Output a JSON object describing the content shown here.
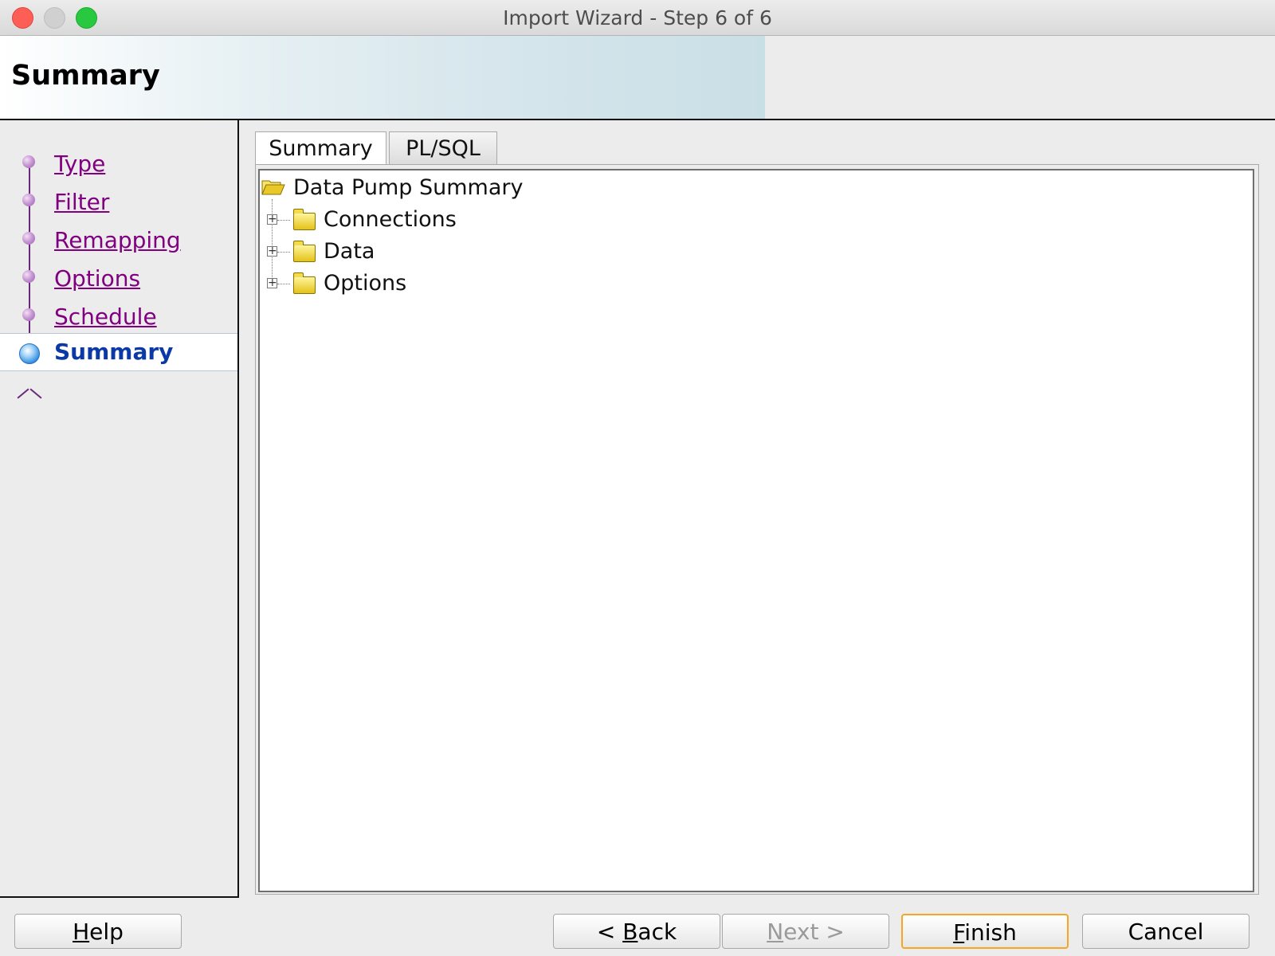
{
  "window": {
    "title": "Import Wizard - Step 6 of 6"
  },
  "header": {
    "title": "Summary"
  },
  "nav": {
    "items": [
      {
        "label": "Type",
        "state": "visited"
      },
      {
        "label": "Filter",
        "state": "visited"
      },
      {
        "label": "Remapping",
        "state": "visited"
      },
      {
        "label": "Options",
        "state": "visited"
      },
      {
        "label": "Schedule",
        "state": "visited"
      },
      {
        "label": "Summary",
        "state": "current"
      }
    ]
  },
  "tabs": [
    {
      "label": "Summary",
      "selected": true
    },
    {
      "label": "PL/SQL",
      "selected": false
    }
  ],
  "tree": {
    "root": {
      "label": "Data Pump Summary",
      "icon": "folder-open-icon"
    },
    "children": [
      {
        "label": "Connections",
        "icon": "folder-icon",
        "expandable": true
      },
      {
        "label": "Data",
        "icon": "folder-icon",
        "expandable": true
      },
      {
        "label": "Options",
        "icon": "folder-icon",
        "expandable": true
      }
    ]
  },
  "buttons": {
    "help": {
      "mnemonic": "H",
      "rest": "elp"
    },
    "back": {
      "prefix": "< ",
      "mnemonic": "B",
      "rest": "ack"
    },
    "next": {
      "mnemonic": "N",
      "rest": "ext >",
      "enabled": false
    },
    "finish": {
      "mnemonic": "F",
      "rest": "inish",
      "default": true
    },
    "cancel": {
      "label": "Cancel"
    }
  },
  "colors": {
    "visited_link": "#800080",
    "current_step": "#0b3aa6",
    "default_button_border": "#f5a623"
  }
}
